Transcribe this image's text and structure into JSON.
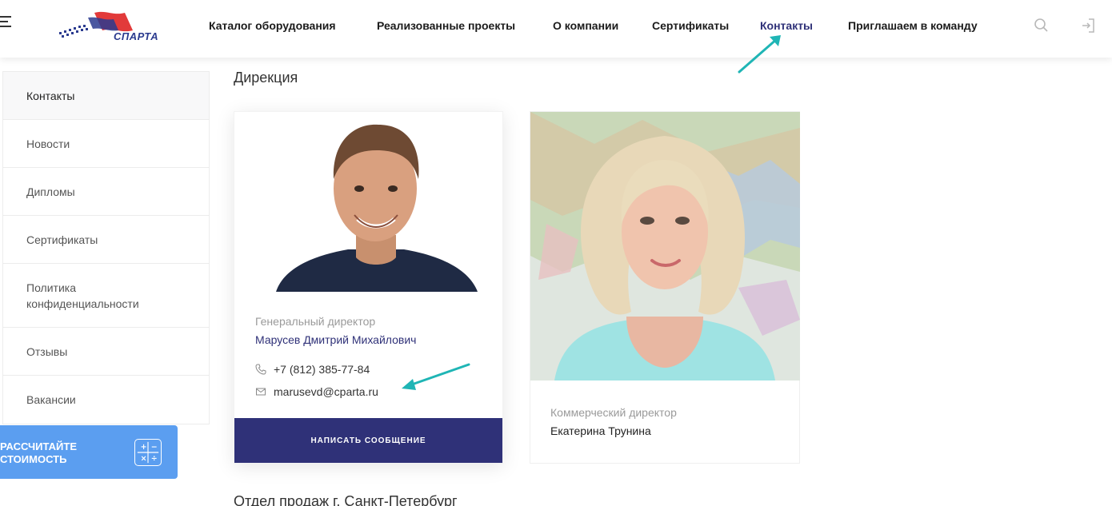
{
  "header": {
    "logo_text": "СПАРТА",
    "nav": [
      {
        "label": "Каталог оборудования",
        "active": false
      },
      {
        "label": "Реализованные проекты",
        "active": false
      },
      {
        "label": "О компании",
        "active": false
      },
      {
        "label": "Сертификаты",
        "active": false
      },
      {
        "label": "Контакты",
        "active": true
      },
      {
        "label": "Приглашаем в команду",
        "active": false
      }
    ],
    "icons": [
      "search-icon",
      "login-icon"
    ]
  },
  "sidebar": {
    "items": [
      {
        "label": "Контакты",
        "active": true
      },
      {
        "label": "Новости",
        "active": false
      },
      {
        "label": "Дипломы",
        "active": false
      },
      {
        "label": "Сертификаты",
        "active": false
      },
      {
        "label": "Политика конфиденциальности",
        "active": false
      },
      {
        "label": "Отзывы",
        "active": false
      },
      {
        "label": "Вакансии",
        "active": false
      }
    ],
    "calc_button": {
      "line1": "РАССЧИТАЙТЕ",
      "line2": "СТОИМОСТЬ"
    }
  },
  "main": {
    "section_title": "Дирекция",
    "next_section_title": "Отдел продаж г. Санкт-Петербург",
    "cards": [
      {
        "role": "Генеральный директор",
        "name": "Марусев Дмитрий Михайлович",
        "phone": "+7 (812) 385-77-84",
        "email": "marusevd@cparta.ru",
        "button": "НАПИСАТЬ СООБЩЕНИЕ"
      },
      {
        "role": "Коммерческий директор",
        "name": "Екатерина Трунина"
      }
    ]
  },
  "colors": {
    "brand_dark": "#2f3178",
    "calc_button": "#5b9ef0",
    "annotation_arrow": "#1fb5b5"
  }
}
